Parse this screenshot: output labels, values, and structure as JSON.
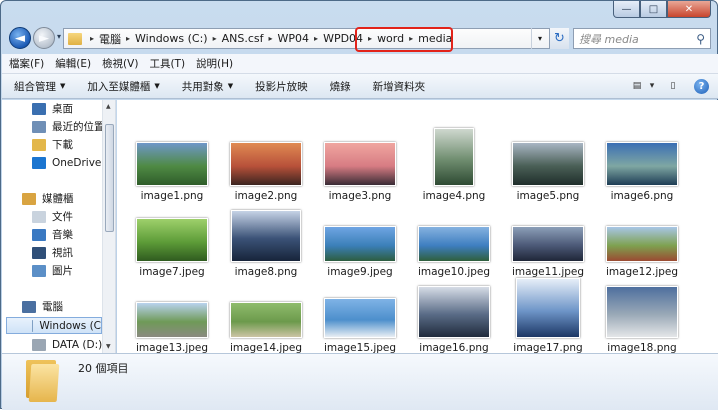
{
  "window": {
    "caption_buttons": {
      "minimize": "—",
      "maximize": "□",
      "close": "✕"
    }
  },
  "navigation": {
    "back_glyph": "◄",
    "forward_glyph": "►",
    "history_glyph": "▾"
  },
  "address_bar": {
    "crumbs": [
      "電腦",
      "Windows (C:)",
      "ANS.csf",
      "WP04",
      "WPD04",
      "word",
      "media"
    ],
    "separator": "▸",
    "dropdown_glyph": "▾",
    "refresh_glyph": "↻",
    "highlight_color": "#e2231a"
  },
  "search": {
    "placeholder": "搜尋 media",
    "icon": "search-icon",
    "glyph": "⚲"
  },
  "menu": [
    "檔案(F)",
    "編輯(E)",
    "檢視(V)",
    "工具(T)",
    "說明(H)"
  ],
  "toolbar": {
    "items": [
      {
        "label": "組合管理",
        "dropdown": true
      },
      {
        "label": "加入至媒體櫃",
        "dropdown": true
      },
      {
        "label": "共用對象",
        "dropdown": true
      },
      {
        "label": "投影片放映",
        "dropdown": false
      },
      {
        "label": "燒錄",
        "dropdown": false
      },
      {
        "label": "新增資料夾",
        "dropdown": false
      }
    ],
    "view_glyph": "▤",
    "view_drop": "▾",
    "preview_glyph": "▯",
    "help": "?"
  },
  "nav_pane": {
    "items": [
      {
        "label": "桌面",
        "icon": "desktop-icon",
        "color": "#3a6fb0"
      },
      {
        "label": "最近的位置",
        "icon": "recent-places-icon",
        "color": "#6f8fb6"
      },
      {
        "label": "下載",
        "icon": "downloads-icon",
        "color": "#e3b74a"
      },
      {
        "label": "OneDrive -",
        "icon": "onedrive-icon",
        "color": "#1b75d0"
      },
      {
        "label": "媒體櫃",
        "icon": "libraries-icon",
        "color": "#d9a441"
      },
      {
        "label": "文件",
        "icon": "documents-icon",
        "color": "#c9d3de"
      },
      {
        "label": "音樂",
        "icon": "music-icon",
        "color": "#3a79c2"
      },
      {
        "label": "視訊",
        "icon": "videos-icon",
        "color": "#2f4f78"
      },
      {
        "label": "圖片",
        "icon": "pictures-icon",
        "color": "#5b8fc7"
      },
      {
        "label": "電腦",
        "icon": "computer-icon",
        "color": "#4a6fa0"
      },
      {
        "label": "Windows (C",
        "icon": "drive-icon",
        "color": "#7fa0c4"
      },
      {
        "label": "DATA (D:)",
        "icon": "drive-icon",
        "color": "#9aa6b3"
      }
    ],
    "selected": "Windows (C",
    "scroll_up": "▲",
    "scroll_down": "▼"
  },
  "files": [
    {
      "name": "image1.png",
      "colors": [
        "#6f97c9",
        "#4f8a44",
        "#2f5d2a"
      ]
    },
    {
      "name": "image2.png",
      "colors": [
        "#e08a52",
        "#b8513a",
        "#3b2420"
      ]
    },
    {
      "name": "image3.png",
      "colors": [
        "#f0a6a0",
        "#d77c83",
        "#3a2c36"
      ]
    },
    {
      "name": "image4.png",
      "colors": [
        "#cfd8cf",
        "#6f8d6f",
        "#2e4a33"
      ]
    },
    {
      "name": "image5.png",
      "colors": [
        "#a9b6c4",
        "#4a5f56",
        "#1f2e2b"
      ]
    },
    {
      "name": "image6.png",
      "colors": [
        "#3b6fb4",
        "#7fa7a3",
        "#1e3d55"
      ]
    },
    {
      "name": "image7.jpeg",
      "colors": [
        "#9ed06b",
        "#5d9c38",
        "#2f5b1f"
      ]
    },
    {
      "name": "image8.png",
      "colors": [
        "#c6d3e6",
        "#3b5277",
        "#17243a"
      ]
    },
    {
      "name": "image9.jpeg",
      "colors": [
        "#6fa5e3",
        "#3b7fb8",
        "#2d5d3f"
      ]
    },
    {
      "name": "image10.jpeg",
      "colors": [
        "#86b2e0",
        "#3e7ec0",
        "#2f5f3c"
      ]
    },
    {
      "name": "image11.jpeg",
      "colors": [
        "#8c9fb8",
        "#4b5876",
        "#1f2638"
      ]
    },
    {
      "name": "image12.jpeg",
      "colors": [
        "#a8c6e6",
        "#7ea14f",
        "#9b4a32"
      ]
    },
    {
      "name": "image13.jpeg",
      "colors": [
        "#b9d2ee",
        "#6f9a58",
        "#8a8a80"
      ]
    },
    {
      "name": "image14.jpeg",
      "colors": [
        "#8fbc6c",
        "#6c9a4c",
        "#ccc4a4"
      ]
    },
    {
      "name": "image15.jpeg",
      "colors": [
        "#7fb3e6",
        "#4d8fcc",
        "#e8eef4"
      ]
    },
    {
      "name": "image16.png",
      "colors": [
        "#d6dce6",
        "#596b86",
        "#202b3c"
      ]
    },
    {
      "name": "image17.png",
      "colors": [
        "#e6eef8",
        "#6e95c8",
        "#1c3765"
      ]
    },
    {
      "name": "image18.png",
      "colors": [
        "#4e6f9e",
        "#9aa9b7",
        "#e4e6e8"
      ]
    }
  ],
  "status": {
    "count_text": "20 個項目"
  }
}
